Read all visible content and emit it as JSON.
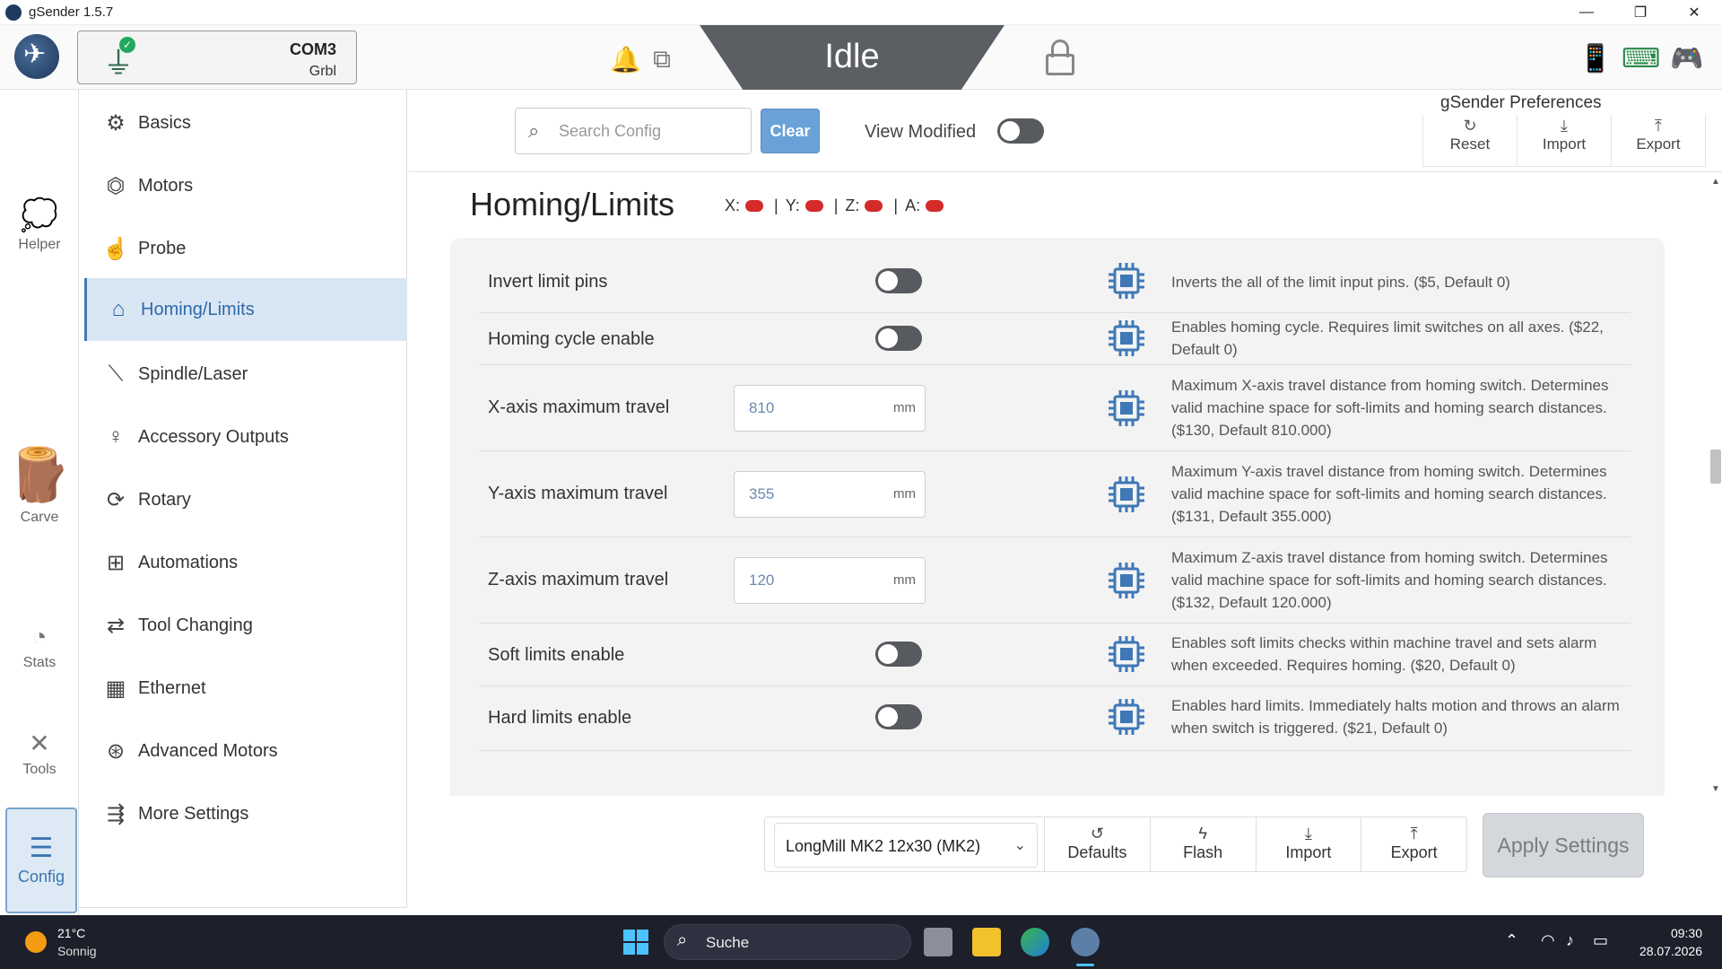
{
  "window": {
    "title": "gSender 1.5.7"
  },
  "header": {
    "port": "COM3",
    "firmware": "Grbl",
    "state": "Idle"
  },
  "rail": [
    {
      "label": "Helper",
      "icon": "helper-icon"
    },
    {
      "label": "Carve",
      "icon": "carve-icon"
    },
    {
      "label": "Stats",
      "icon": "gauge-icon"
    },
    {
      "label": "Tools",
      "icon": "tools-icon"
    },
    {
      "label": "Config",
      "icon": "config-list-icon",
      "active": true
    }
  ],
  "nav": [
    {
      "label": "Basics",
      "icon": "gear-icon"
    },
    {
      "label": "Motors",
      "icon": "motor-icon"
    },
    {
      "label": "Probe",
      "icon": "probe-icon"
    },
    {
      "label": "Homing/Limits",
      "icon": "home-icon",
      "active": true
    },
    {
      "label": "Spindle/Laser",
      "icon": "spindle-icon"
    },
    {
      "label": "Accessory Outputs",
      "icon": "pin-icon"
    },
    {
      "label": "Rotary",
      "icon": "rotary-icon"
    },
    {
      "label": "Automations",
      "icon": "robot-icon"
    },
    {
      "label": "Tool Changing",
      "icon": "swap-icon"
    },
    {
      "label": "Ethernet",
      "icon": "ethernet-icon"
    },
    {
      "label": "Advanced Motors",
      "icon": "advanced-motor-icon"
    },
    {
      "label": "More Settings",
      "icon": "list-indent-icon"
    }
  ],
  "toolbar": {
    "search_placeholder": "Search Config",
    "clear_label": "Clear",
    "view_modified_label": "View Modified",
    "view_modified_on": false
  },
  "prefs": {
    "title": "gSender Preferences",
    "reset": "Reset",
    "import": "Import",
    "export": "Export"
  },
  "section": {
    "title": "Homing/Limits",
    "axes": [
      "X:",
      "Y:",
      "Z:",
      "A:"
    ],
    "axis_sep": "|",
    "axis_color": "#d42a2a"
  },
  "settings": [
    {
      "label": "Invert limit pins",
      "type": "toggle",
      "value": false,
      "desc": "Inverts the all of the limit input pins. ($5, Default 0)"
    },
    {
      "label": "Homing cycle enable",
      "type": "toggle",
      "value": false,
      "desc": "Enables homing cycle. Requires limit switches on all axes. ($22, Default 0)"
    },
    {
      "label": "X-axis maximum travel",
      "type": "number",
      "value": "810",
      "unit": "mm",
      "desc": "Maximum X-axis travel distance from homing switch. Determines valid machine space for soft-limits and homing search distances. ($130, Default 810.000)"
    },
    {
      "label": "Y-axis maximum travel",
      "type": "number",
      "value": "355",
      "unit": "mm",
      "desc": "Maximum Y-axis travel distance from homing switch. Determines valid machine space for soft-limits and homing search distances. ($131, Default 355.000)"
    },
    {
      "label": "Z-axis maximum travel",
      "type": "number",
      "value": "120",
      "unit": "mm",
      "desc": "Maximum Z-axis travel distance from homing switch. Determines valid machine space for soft-limits and homing search distances. ($132, Default 120.000)"
    },
    {
      "label": "Soft limits enable",
      "type": "toggle",
      "value": false,
      "desc": "Enables soft limits checks within machine travel and sets alarm when exceeded. Requires homing. ($20, Default 0)"
    },
    {
      "label": "Hard limits enable",
      "type": "toggle",
      "value": false,
      "desc": "Enables hard limits. Immediately halts motion and throws an alarm when switch is triggered. ($21, Default 0)"
    }
  ],
  "footer": {
    "machine": "LongMill MK2 12x30 (MK2)",
    "defaults": "Defaults",
    "flash": "Flash",
    "import": "Import",
    "export": "Export",
    "apply": "Apply Settings"
  },
  "taskbar": {
    "temp": "21°C",
    "condition": "Sonnig",
    "search": "Suche",
    "time": "09:30",
    "date": "28.07.2026"
  },
  "colors": {
    "accent": "#3f78b5",
    "toggle_off": "#575a5e",
    "chip": "#3f78b5"
  }
}
